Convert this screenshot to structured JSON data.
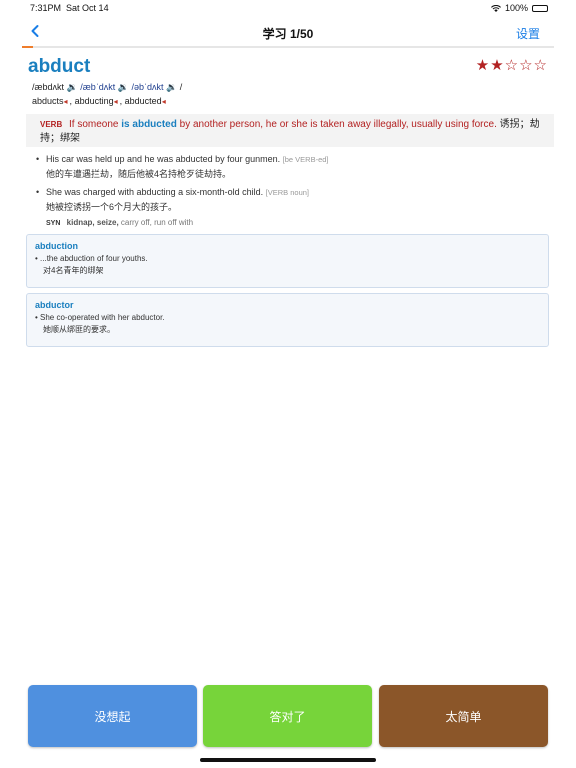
{
  "status_bar": {
    "time": "7:31PM",
    "date": "Sat Oct 14",
    "battery": "100%"
  },
  "nav": {
    "back_icon": "chevron-left-icon",
    "title": "学习 1/50",
    "settings_label": "设置"
  },
  "progress": {
    "current": 1,
    "total": 50,
    "color": "#ef7d2b"
  },
  "word": {
    "headword": "abduct",
    "stars_filled": "★★",
    "stars_empty": "☆☆☆",
    "rating": 2,
    "max_rating": 5,
    "pron_1": "/æbdʌkt",
    "pron_2": "/æbˈdʌkt",
    "pron_3": "/əbˈdʌkt",
    "pron_end": "/",
    "forms": [
      "abducts",
      "abducting",
      "abducted"
    ]
  },
  "definition": {
    "pos": "VERB",
    "text_before": "If someone",
    "is_label": "is abducted",
    "text_after": "by another person, he or she is taken away illegally, usually using force.",
    "zh": "诱拐；劫持；绑架"
  },
  "examples": [
    {
      "en": "His car was held up and he was abducted by four gunmen.",
      "grammar": "[be VERB-ed]",
      "zh": "他的车遭遇拦劫，随后他被4名持枪歹徒劫持。"
    },
    {
      "en": "She was charged with abducting a six-month-old child.",
      "grammar": "[VERB noun]",
      "zh": "她被控诱拐一个6个月大的孩子。"
    }
  ],
  "synonyms": {
    "label": "SYN",
    "bold": "kidnap, seize,",
    "rest": "carry off, run off with"
  },
  "related": [
    {
      "title": "abduction",
      "en": "• ...the abduction of four youths.",
      "zh": "对4名青年的绑架"
    },
    {
      "title": "abductor",
      "en": "• She co-operated with her abductor.",
      "zh": "她顺从绑匪的要求。"
    }
  ],
  "buttons": {
    "forgot": "没想起",
    "correct": "答对了",
    "easy": "太简单"
  }
}
